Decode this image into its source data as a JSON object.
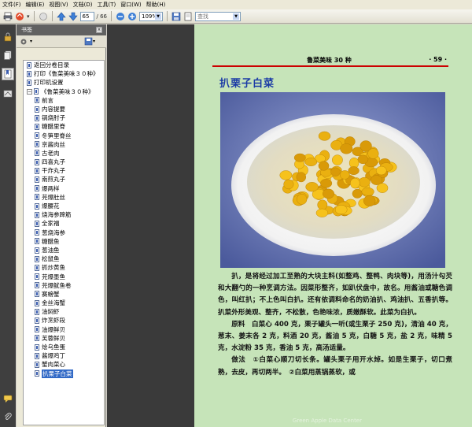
{
  "menu": [
    "文件(F)",
    "编辑(E)",
    "视图(V)",
    "文档(D)",
    "工具(T)",
    "窗口(W)",
    "帮助(H)"
  ],
  "toolbar": {
    "page_current": "65",
    "page_total": "/ 66",
    "zoom": "109%",
    "search_placeholder": "查找"
  },
  "panel": {
    "title": "书签",
    "close": "×"
  },
  "bookmarks": [
    {
      "label": "返回分卷目录",
      "level": 0
    },
    {
      "label": "打印《鲁菜美味３０种》",
      "level": 0
    },
    {
      "label": "打印机设置",
      "level": 0
    },
    {
      "label": "《鲁菜美味３０种》",
      "level": 0,
      "toggle": "−"
    },
    {
      "label": "前言",
      "level": 1
    },
    {
      "label": "内容提要",
      "level": 1
    },
    {
      "label": "锅烧肘子",
      "level": 1
    },
    {
      "label": "糖醋里脊",
      "level": 1
    },
    {
      "label": "冬笋里脊丝",
      "level": 1
    },
    {
      "label": "京酱肉丝",
      "level": 1
    },
    {
      "label": "古老肉",
      "level": 1
    },
    {
      "label": "四喜丸子",
      "level": 1
    },
    {
      "label": "干炸丸子",
      "level": 1
    },
    {
      "label": "南煎丸子",
      "level": 1
    },
    {
      "label": "爆两样",
      "level": 1
    },
    {
      "label": "芫爆肚丝",
      "level": 1
    },
    {
      "label": "爆腰花",
      "level": 1
    },
    {
      "label": "烧海参蹄筋",
      "level": 1
    },
    {
      "label": "全家福",
      "level": 1
    },
    {
      "label": "葱烧海参",
      "level": 1
    },
    {
      "label": "糖醋鱼",
      "level": 1
    },
    {
      "label": "葱油鱼",
      "level": 1
    },
    {
      "label": "松鼠鱼",
      "level": 1
    },
    {
      "label": "抓炒黄鱼",
      "level": 1
    },
    {
      "label": "芫爆墨鱼",
      "level": 1
    },
    {
      "label": "芫爆鱿鱼卷",
      "level": 1
    },
    {
      "label": "赛螃蟹",
      "level": 1
    },
    {
      "label": "金丝海蟹",
      "level": 1
    },
    {
      "label": "油焖虾",
      "level": 1
    },
    {
      "label": "炸烹虾段",
      "level": 1
    },
    {
      "label": "油爆鲜贝",
      "level": 1
    },
    {
      "label": "芙蓉鲜贝",
      "level": 1
    },
    {
      "label": "烩乌鱼蛋",
      "level": 1
    },
    {
      "label": "酱爆鸡丁",
      "level": 1
    },
    {
      "label": "蟹肉菜心",
      "level": 1
    },
    {
      "label": "扒栗子白菜",
      "level": 1,
      "selected": true
    }
  ],
  "page": {
    "running_head_title": "鲁菜美味 30 种",
    "running_head_page": "· 59 ·",
    "title": "扒栗子白菜",
    "paragraphs": [
      "扒，是将经过加工至熟的大块主料(如整鸡、整鸭、肉块等)，用汤汁勾芡和大翻勺的一种烹调方法。因菜形整齐，如趴伏盘中，故名。用酱油或糖色调色，叫红扒；不上色叫白扒。还有依调料命名的奶油扒、鸡油扒、五香扒等。扒菜外形美观、整齐，不松散，色艳味浓，质嫩酥软。此菜为白扒。",
      "原料　白菜心 400 克，栗子罐头一听(或生栗子 250 克)，清油 40 克，葱末、姜末各 2 克，料酒 20 克，酱油 5 克，白糖 5 克，盐 2 克，味精 5 克，水淀粉 35 克，香油 5 克，高汤适量。",
      "做法　①白菜心顺刀切长条。罐头栗子用开水焯。如是生栗子，切口煮熟，去皮，再切两半。　②白菜用蒸锅蒸软，或"
    ],
    "watermark": "Green Apple Data Center"
  }
}
